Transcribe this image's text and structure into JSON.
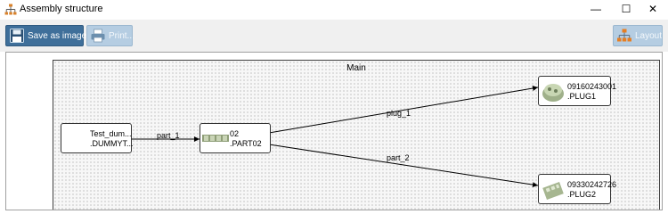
{
  "window": {
    "title": "Assembly structure",
    "icon": "tree-structure-icon",
    "controls": {
      "minimize": "—",
      "maximize": "☐",
      "close": "✕"
    }
  },
  "toolbar": {
    "save_label": "Save as image...",
    "save_icon": "floppy-disk-icon",
    "print_label": "Print...",
    "print_icon": "printer-icon",
    "layout_label": "Layout",
    "layout_icon": "hierarchy-layout-icon"
  },
  "diagram": {
    "group_label": "Main",
    "nodes": [
      {
        "id": "root",
        "line1": "Test_dum...",
        "line2": ".DUMMYT..."
      },
      {
        "id": "part02",
        "line1": "02",
        "line2": ".PART02"
      },
      {
        "id": "plug1",
        "line1": "09160243001",
        "line2": ".PLUG1"
      },
      {
        "id": "plug2",
        "line1": "09330242726",
        "line2": ".PLUG2"
      }
    ],
    "edges": [
      {
        "from": "root",
        "to": "part02",
        "label": "part_1"
      },
      {
        "from": "part02",
        "to": "plug1",
        "label": "plug_1"
      },
      {
        "from": "part02",
        "to": "plug2",
        "label": "part_2"
      }
    ]
  },
  "colors": {
    "primary_button": "#3f6f9a",
    "disabled_button": "#b5cde2",
    "group_border": "#404040"
  }
}
